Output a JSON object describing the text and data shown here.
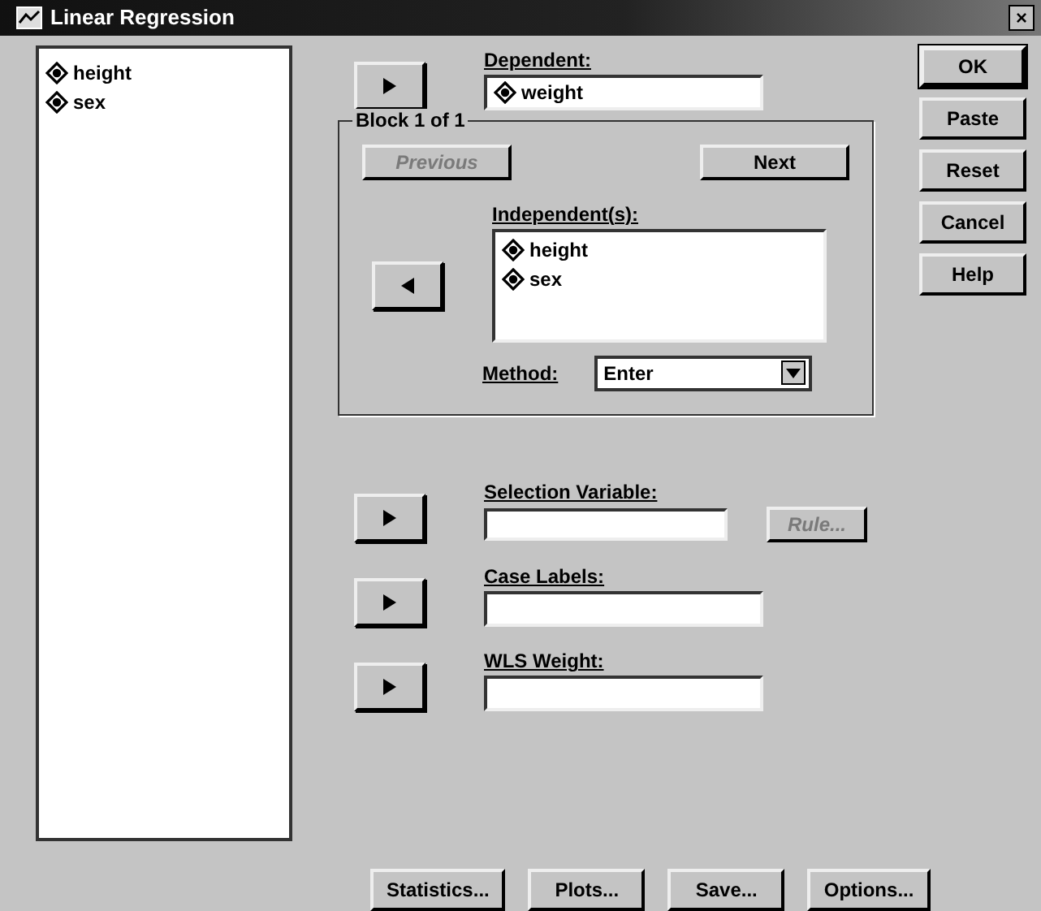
{
  "window": {
    "title": "Linear Regression",
    "close": "×"
  },
  "source_list": [
    {
      "name": "height"
    },
    {
      "name": "sex"
    }
  ],
  "dependent": {
    "label": "Dependent:",
    "value": "weight"
  },
  "block": {
    "title": "Block 1 of 1",
    "previous": {
      "label": "Previous",
      "disabled": true
    },
    "next": {
      "label": "Next",
      "disabled": false
    },
    "independents_label": "Independent(s):",
    "independents": [
      {
        "name": "height"
      },
      {
        "name": "sex"
      }
    ],
    "method_label": "Method:",
    "method": "Enter"
  },
  "selection_variable": {
    "label": "Selection Variable:",
    "rule": {
      "label": "Rule...",
      "disabled": true
    }
  },
  "case_labels": {
    "label": "Case Labels:"
  },
  "wls_weight": {
    "label": "WLS Weight:"
  },
  "side_buttons": [
    {
      "label": "OK",
      "default": true
    },
    {
      "label": "Paste",
      "default": false
    },
    {
      "label": "Reset",
      "default": false
    },
    {
      "label": "Cancel",
      "default": false
    },
    {
      "label": "Help",
      "default": false
    }
  ],
  "bottom_buttons": [
    {
      "label": "Statistics..."
    },
    {
      "label": "Plots..."
    },
    {
      "label": "Save..."
    },
    {
      "label": "Options..."
    }
  ]
}
